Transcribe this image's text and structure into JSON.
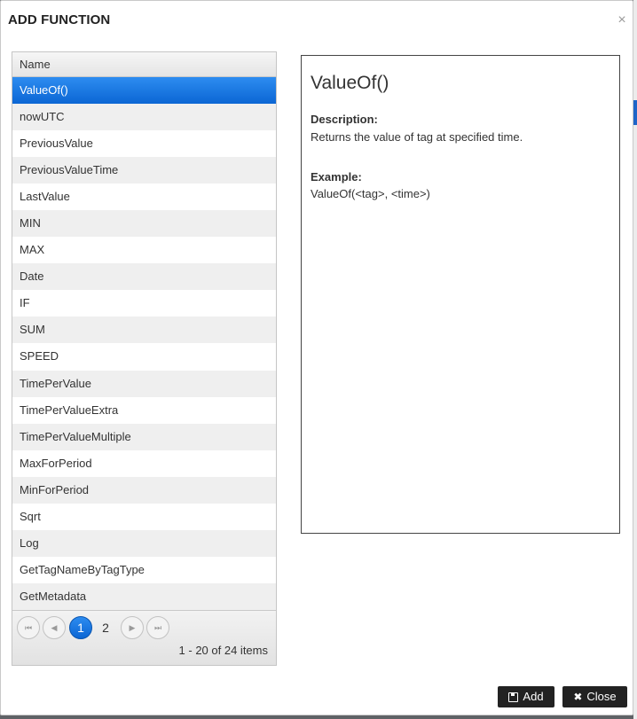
{
  "dialog": {
    "title": "ADD FUNCTION",
    "close_glyph": "×"
  },
  "grid": {
    "column_header": "Name",
    "selected_index": 0,
    "rows": [
      "ValueOf()",
      "nowUTC",
      "PreviousValue",
      "PreviousValueTime",
      "LastValue",
      "MIN",
      "MAX",
      "Date",
      "IF",
      "SUM",
      "SPEED",
      "TimePerValue",
      "TimePerValueExtra",
      "TimePerValueMultiple",
      "MaxForPeriod",
      "MinForPeriod",
      "Sqrt",
      "Log",
      "GetTagNameByTagType",
      "GetMetadata"
    ]
  },
  "pager": {
    "first_glyph": "⏮",
    "prev_glyph": "◀",
    "next_glyph": "▶",
    "last_glyph": "⏭",
    "pages": [
      "1",
      "2"
    ],
    "current_page": "1",
    "info": "1 - 20 of 24 items"
  },
  "detail": {
    "function_name": "ValueOf()",
    "description_label": "Description:",
    "description": "Returns the value of tag at specified time.",
    "example_label": "Example:",
    "example": "ValueOf(<tag>, <time>)"
  },
  "footer": {
    "add_label": "Add",
    "close_label": "Close",
    "add_icon": "save-icon",
    "close_icon": "x-icon"
  },
  "colors": {
    "selected_row": "#1a73de",
    "button_bg": "#222222",
    "accent_band": "#1f65c8"
  }
}
